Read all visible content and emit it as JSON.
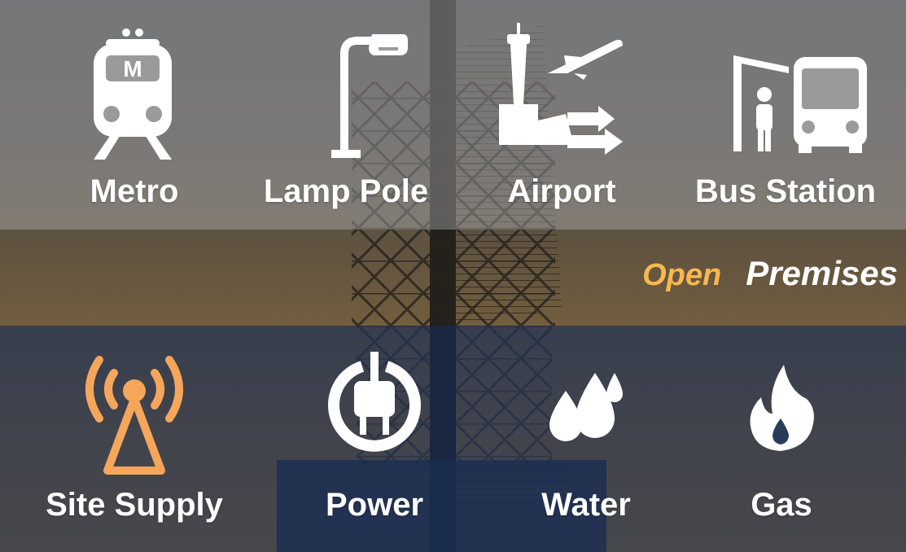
{
  "colors": {
    "icon_white": "#ffffff",
    "site_supply_orange": "#f5a65b",
    "open_yellow": "#f7b84f"
  },
  "top_row": [
    {
      "label": "Metro",
      "icon": "metro-train-icon"
    },
    {
      "label": "Lamp Pole",
      "icon": "lamp-pole-icon"
    },
    {
      "label": "Airport",
      "icon": "airport-icon"
    },
    {
      "label": "Bus Station",
      "icon": "bus-station-icon"
    }
  ],
  "tagline": {
    "open": "Open",
    "premises": "Premises"
  },
  "bottom_row": [
    {
      "label": "Site Supply",
      "icon": "antenna-tower-icon"
    },
    {
      "label": "Power",
      "icon": "power-plug-icon"
    },
    {
      "label": "Water",
      "icon": "water-drops-icon"
    },
    {
      "label": "Gas",
      "icon": "flame-icon"
    }
  ],
  "metro_badge": "M"
}
